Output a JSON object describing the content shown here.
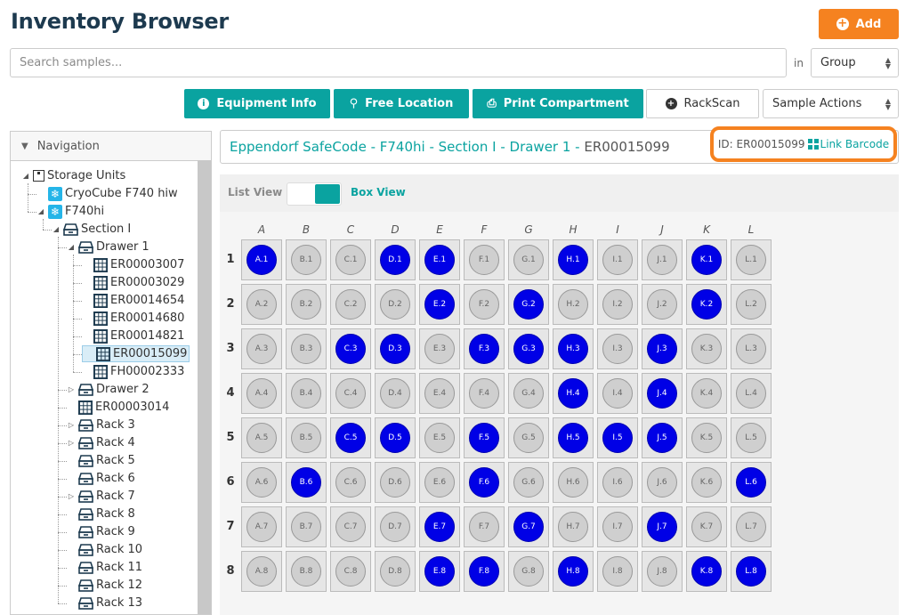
{
  "header": {
    "title": "Inventory Browser",
    "add_label": "Add"
  },
  "search": {
    "placeholder": "Search samples...",
    "in_label": "in",
    "scope_value": "Group"
  },
  "toolbar": {
    "equipment_info": "Equipment Info",
    "free_location": "Free Location",
    "print_compartment": "Print Compartment",
    "rackscan": "RackScan",
    "sample_actions": "Sample Actions"
  },
  "nav": {
    "title": "Navigation",
    "tree": [
      {
        "label": "Storage Units",
        "icon": "box",
        "level": 0,
        "expanded": true
      },
      {
        "label": "CryoCube F740 hiw",
        "icon": "freezer",
        "level": 1
      },
      {
        "label": "F740hi",
        "icon": "freezer",
        "level": 1,
        "expanded": true
      },
      {
        "label": "Section I",
        "icon": "drawer",
        "level": 2,
        "expanded": true
      },
      {
        "label": "Drawer 1",
        "icon": "drawer",
        "level": 3,
        "expanded": true
      },
      {
        "label": "ER00003007",
        "icon": "grid",
        "level": 4
      },
      {
        "label": "ER00003029",
        "icon": "grid",
        "level": 4
      },
      {
        "label": "ER00014654",
        "icon": "grid",
        "level": 4
      },
      {
        "label": "ER00014680",
        "icon": "grid",
        "level": 4
      },
      {
        "label": "ER00014821",
        "icon": "grid",
        "level": 4
      },
      {
        "label": "ER00015099",
        "icon": "grid",
        "level": 4,
        "selected": true
      },
      {
        "label": "FH00002333",
        "icon": "grid",
        "level": 4
      },
      {
        "label": "Drawer 2",
        "icon": "drawer",
        "level": 3,
        "collapsed": true
      },
      {
        "label": "ER00003014",
        "icon": "grid",
        "level": 3
      },
      {
        "label": "Rack 3",
        "icon": "drawer",
        "level": 3,
        "collapsed": true
      },
      {
        "label": "Rack 4",
        "icon": "drawer",
        "level": 3,
        "collapsed": true
      },
      {
        "label": "Rack 5",
        "icon": "drawer",
        "level": 3
      },
      {
        "label": "Rack 6",
        "icon": "drawer",
        "level": 3
      },
      {
        "label": "Rack 7",
        "icon": "drawer",
        "level": 3,
        "collapsed": true
      },
      {
        "label": "Rack 8",
        "icon": "drawer",
        "level": 3
      },
      {
        "label": "Rack 9",
        "icon": "drawer",
        "level": 3
      },
      {
        "label": "Rack 10",
        "icon": "drawer",
        "level": 3
      },
      {
        "label": "Rack 11",
        "icon": "drawer",
        "level": 3
      },
      {
        "label": "Rack 12",
        "icon": "drawer",
        "level": 3
      },
      {
        "label": "Rack 13",
        "icon": "drawer",
        "level": 3
      }
    ]
  },
  "path": {
    "segments": [
      "Eppendorf SafeCode",
      "F740hi",
      "Section I",
      "Drawer 1"
    ],
    "separator": " - ",
    "current": "ER00015099"
  },
  "id_box": {
    "id_text": "ID: ER00015099",
    "link_label": "Link Barcode"
  },
  "view": {
    "list_label": "List View",
    "box_label": "Box View",
    "mode": "box"
  },
  "box": {
    "columns": [
      "A",
      "B",
      "C",
      "D",
      "E",
      "F",
      "G",
      "H",
      "I",
      "J",
      "K",
      "L"
    ],
    "rows": [
      "1",
      "2",
      "3",
      "4",
      "5",
      "6",
      "7",
      "8"
    ],
    "filled": [
      "A.1",
      "D.1",
      "E.1",
      "H.1",
      "K.1",
      "E.2",
      "G.2",
      "K.2",
      "C.3",
      "D.3",
      "F.3",
      "G.3",
      "H.3",
      "J.3",
      "H.4",
      "J.4",
      "C.5",
      "D.5",
      "F.5",
      "H.5",
      "I.5",
      "J.5",
      "B.6",
      "F.6",
      "L.6",
      "E.7",
      "G.7",
      "J.7",
      "E.8",
      "F.8",
      "H.8",
      "K.8",
      "L.8"
    ]
  },
  "colors": {
    "teal": "#0aa3a0",
    "orange": "#f58220",
    "filled_tube": "#0000e6",
    "empty_tube": "#cfcfcf"
  }
}
